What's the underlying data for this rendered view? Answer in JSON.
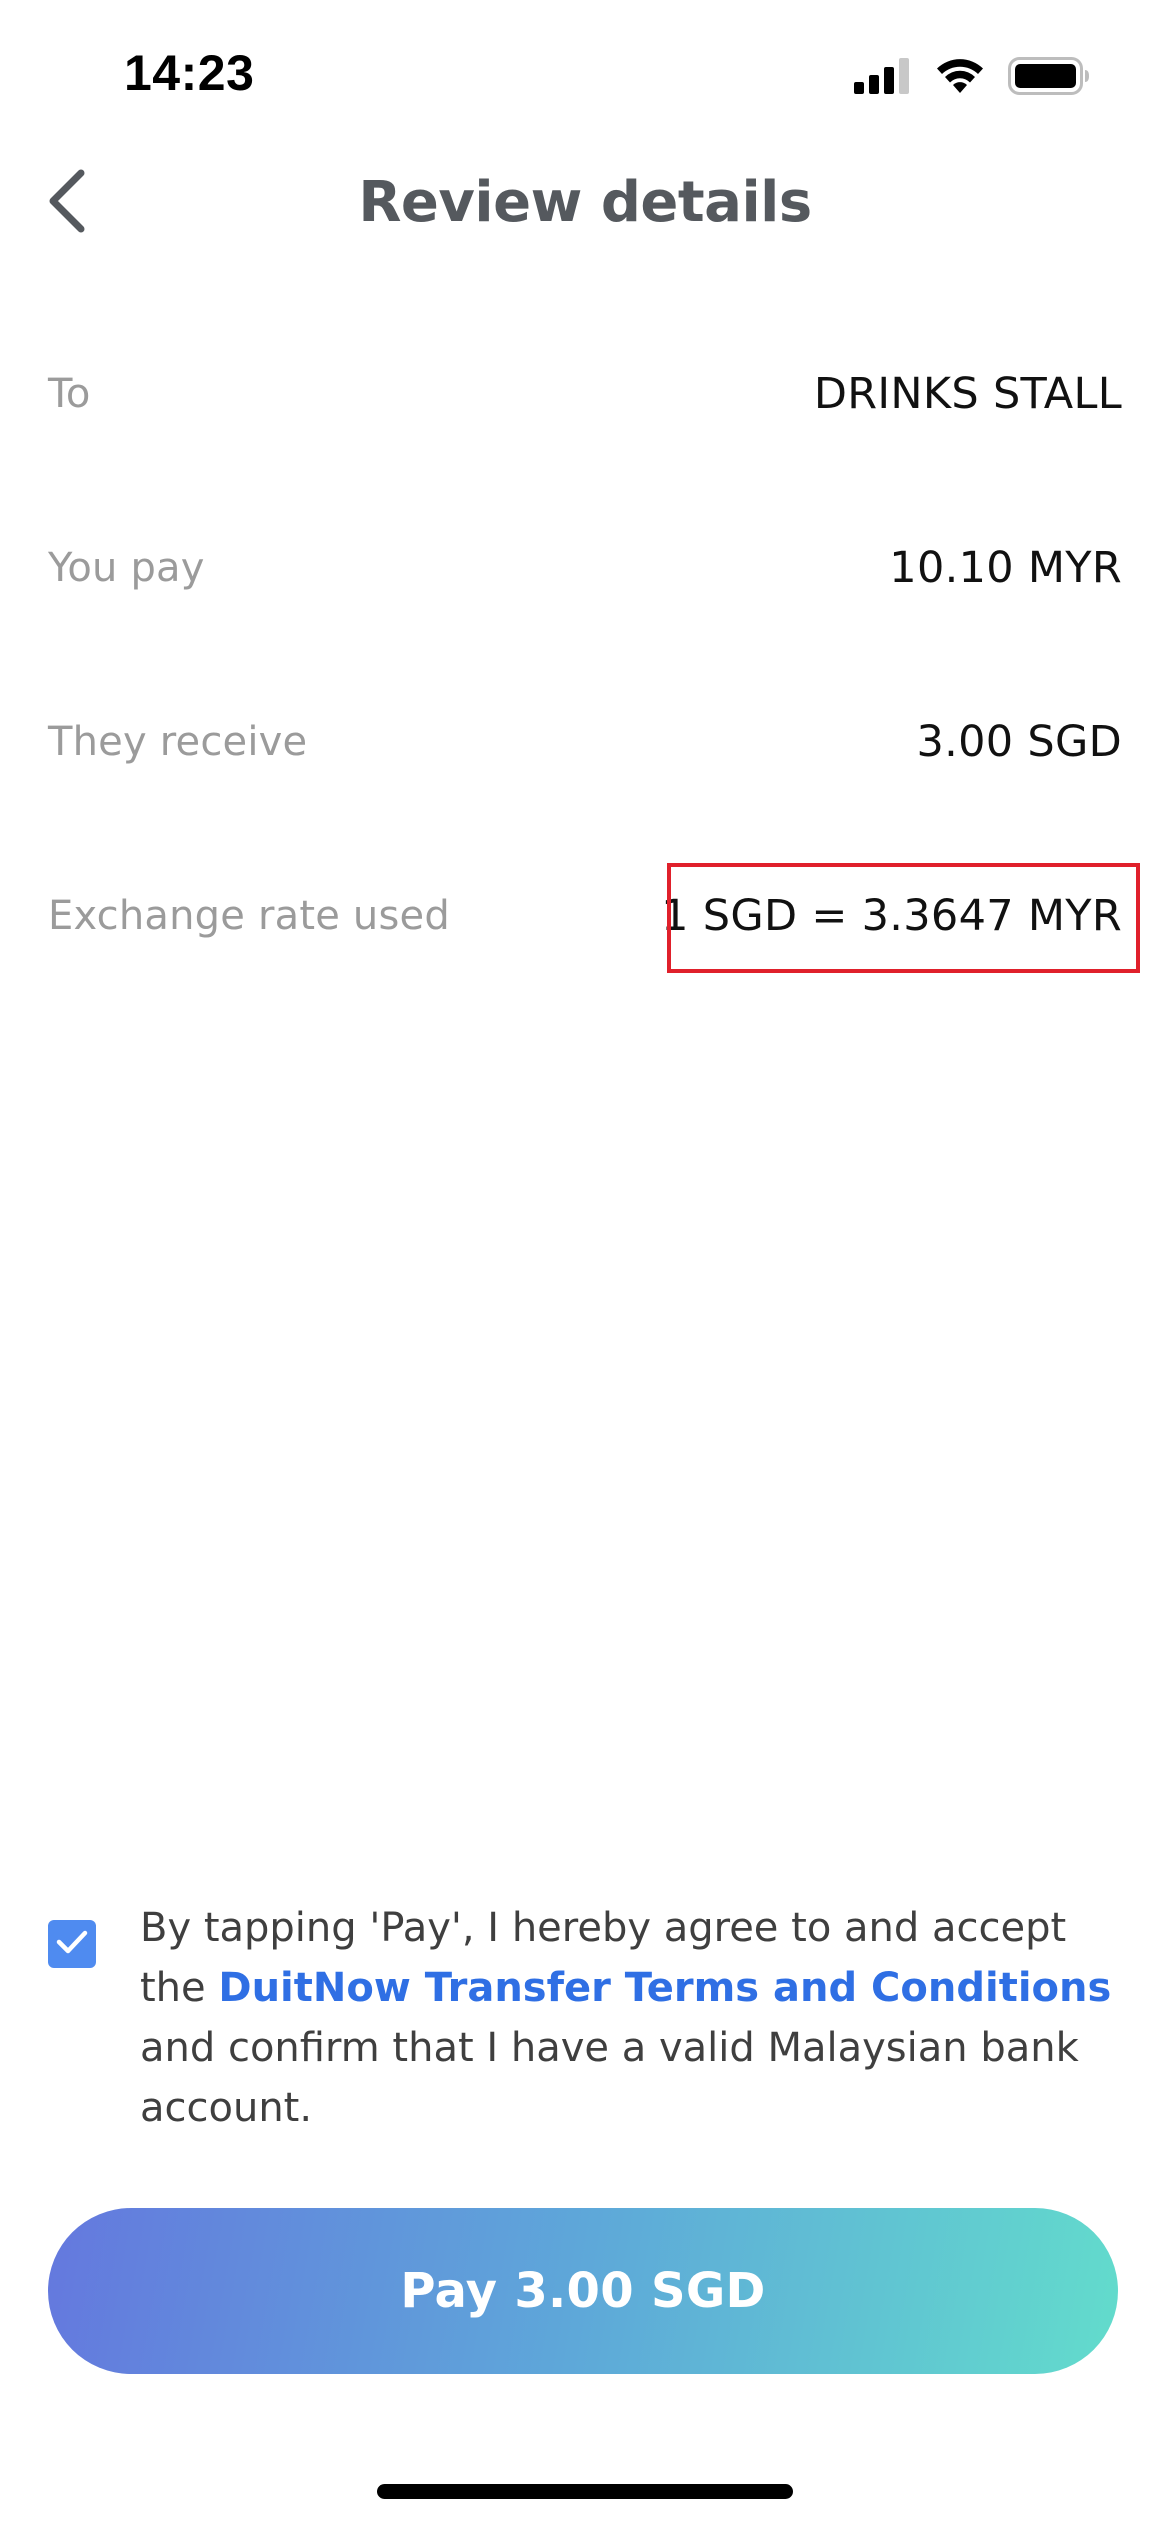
{
  "status_bar": {
    "time": "14:23",
    "icons": [
      "cellular-signal-icon",
      "wifi-icon",
      "battery-icon"
    ]
  },
  "header": {
    "title": "Review details",
    "back_icon": "chevron-left-icon"
  },
  "details": [
    {
      "label": "To",
      "value": "DRINKS STALL"
    },
    {
      "label": "You pay",
      "value": "10.10 MYR"
    },
    {
      "label": "They receive",
      "value": "3.00 SGD"
    },
    {
      "label": "Exchange rate used",
      "value": "1 SGD = 3.3647 MYR"
    }
  ],
  "highlight_color": "#e0202b",
  "agreement": {
    "checked": true,
    "text_before": "By tapping 'Pay', I hereby agree to and accept the ",
    "link_text": "DuitNow Transfer Terms and Conditions",
    "text_after": " and confirm that I have a valid Malaysian bank account.",
    "link_color": "#2f6fe4",
    "checkbox_color": "#4f8bf0"
  },
  "pay_button": {
    "label": "Pay 3.00 SGD",
    "gradient": [
      "#6478de",
      "#5ea8d9",
      "#62dccc"
    ]
  }
}
